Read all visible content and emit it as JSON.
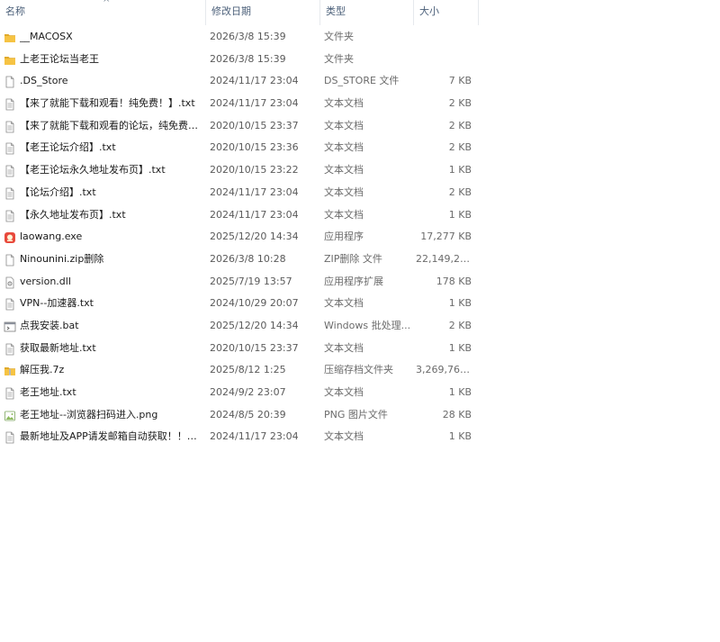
{
  "columns": {
    "name": "名称",
    "date": "修改日期",
    "type": "类型",
    "size": "大小",
    "sort_indicator": "^"
  },
  "files": [
    {
      "name": "__MACOSX",
      "date": "2026/3/8 15:39",
      "type": "文件夹",
      "size": "",
      "icon": "folder-icon"
    },
    {
      "name": "上老王论坛当老王",
      "date": "2026/3/8 15:39",
      "type": "文件夹",
      "size": "",
      "icon": "folder-icon"
    },
    {
      "name": ".DS_Store",
      "date": "2024/11/17 23:04",
      "type": "DS_STORE 文件",
      "size": "7 KB",
      "icon": "file-icon"
    },
    {
      "name": "【来了就能下载和观看！纯免费！】.txt",
      "date": "2024/11/17 23:04",
      "type": "文本文档",
      "size": "2 KB",
      "icon": "text-file-icon"
    },
    {
      "name": "【来了就能下载和观看的论坛，纯免费！...",
      "date": "2020/10/15 23:37",
      "type": "文本文档",
      "size": "2 KB",
      "icon": "text-file-icon"
    },
    {
      "name": "【老王论坛介绍】.txt",
      "date": "2020/10/15 23:36",
      "type": "文本文档",
      "size": "2 KB",
      "icon": "text-file-icon"
    },
    {
      "name": "【老王论坛永久地址发布页】.txt",
      "date": "2020/10/15 23:22",
      "type": "文本文档",
      "size": "1 KB",
      "icon": "text-file-icon"
    },
    {
      "name": "【论坛介绍】.txt",
      "date": "2024/11/17 23:04",
      "type": "文本文档",
      "size": "2 KB",
      "icon": "text-file-icon"
    },
    {
      "name": "【永久地址发布页】.txt",
      "date": "2024/11/17 23:04",
      "type": "文本文档",
      "size": "1 KB",
      "icon": "text-file-icon"
    },
    {
      "name": "laowang.exe",
      "date": "2025/12/20 14:34",
      "type": "应用程序",
      "size": "17,277 KB",
      "icon": "app-icon"
    },
    {
      "name": "Ninounini.zip删除",
      "date": "2026/3/8 10:28",
      "type": "ZIP删除 文件",
      "size": "22,149,26...",
      "icon": "file-icon"
    },
    {
      "name": "version.dll",
      "date": "2025/7/19 13:57",
      "type": "应用程序扩展",
      "size": "178 KB",
      "icon": "dll-icon"
    },
    {
      "name": "VPN--加速器.txt",
      "date": "2024/10/29 20:07",
      "type": "文本文档",
      "size": "1 KB",
      "icon": "text-file-icon"
    },
    {
      "name": "点我安装.bat",
      "date": "2025/12/20 14:34",
      "type": "Windows 批处理...",
      "size": "2 KB",
      "icon": "batch-file-icon"
    },
    {
      "name": "获取最新地址.txt",
      "date": "2020/10/15 23:37",
      "type": "文本文档",
      "size": "1 KB",
      "icon": "text-file-icon"
    },
    {
      "name": "解压我.7z",
      "date": "2025/8/12 1:25",
      "type": "压缩存档文件夹",
      "size": "3,269,762...",
      "icon": "archive-icon"
    },
    {
      "name": "老王地址.txt",
      "date": "2024/9/2 23:07",
      "type": "文本文档",
      "size": "1 KB",
      "icon": "text-file-icon"
    },
    {
      "name": "老王地址--浏览器扫码进入.png",
      "date": "2024/8/5 20:39",
      "type": "PNG 图片文件",
      "size": "28 KB",
      "icon": "image-file-icon"
    },
    {
      "name": "最新地址及APP请发邮箱自动获取！！！...",
      "date": "2024/11/17 23:04",
      "type": "文本文档",
      "size": "1 KB",
      "icon": "text-file-icon"
    }
  ],
  "colors": {
    "folder": "#f6c343",
    "folder_dark": "#e0a92a",
    "header_text": "#4c607a",
    "app_icon": "#e8493c"
  }
}
